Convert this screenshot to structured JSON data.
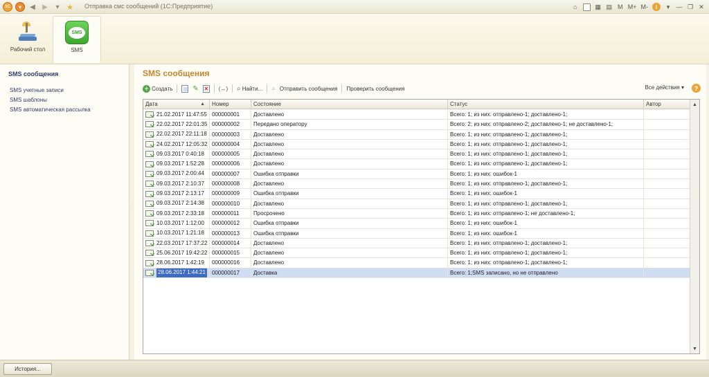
{
  "window": {
    "title": "Отправка смс сообщений  (1С:Предприятие)",
    "logo_text": "1С",
    "right_buttons": [
      "M",
      "M+",
      "M-"
    ]
  },
  "sections": [
    {
      "label": "Рабочий стол",
      "icon": "desktop-icon",
      "active": false
    },
    {
      "label": "SMS",
      "icon": "sms-icon",
      "active": true
    }
  ],
  "sms_icon_text": "SMS",
  "nav": {
    "header": "SMS сообщения",
    "items": [
      "SMS учетные записи",
      "SMS шаблоны",
      "SMS автоматическая рассылка"
    ]
  },
  "form": {
    "title": "SMS сообщения",
    "toolbar": {
      "create": "Создать",
      "find": "Найти...",
      "send": "Отправить сообщения",
      "check": "Проверить сообщения",
      "all_actions": "Все действия ▾",
      "exchange": "(↔)"
    }
  },
  "table": {
    "columns": [
      "Дата",
      "Номер",
      "Состояние",
      "Статус",
      "Автор"
    ],
    "rows": [
      {
        "date": "21.02.2017 11:47:55",
        "number": "000000001",
        "state": "Доставлено",
        "status": "Всего: 1; из них: отправлено-1; доставлено-1;",
        "author": ""
      },
      {
        "date": "22.02.2017 22:01:35",
        "number": "000000002",
        "state": "Передано оператору",
        "status": "Всего: 2; из них: отправлено-2; доставлено-1; не доставлено-1;",
        "author": ""
      },
      {
        "date": "22.02.2017 22:11:18",
        "number": "000000003",
        "state": "Доставлено",
        "status": "Всего: 1; из них: отправлено-1; доставлено-1;",
        "author": ""
      },
      {
        "date": "24.02.2017 12:05:32",
        "number": "000000004",
        "state": "Доставлено",
        "status": "Всего: 1; из них: отправлено-1; доставлено-1;",
        "author": ""
      },
      {
        "date": "09.03.2017 0:40:18",
        "number": "000000005",
        "state": "Доставлено",
        "status": "Всего: 1; из них: отправлено-1; доставлено-1;",
        "author": ""
      },
      {
        "date": "09.03.2017 1:52:28",
        "number": "000000006",
        "state": "Доставлено",
        "status": "Всего: 1; из них: отправлено-1; доставлено-1;",
        "author": ""
      },
      {
        "date": "09.03.2017 2:00:44",
        "number": "000000007",
        "state": "Ошибка отправки",
        "status": "Всего: 1; из них: ошибок-1",
        "author": ""
      },
      {
        "date": "09.03.2017 2:10:37",
        "number": "000000008",
        "state": "Доставлено",
        "status": "Всего: 1; из них: отправлено-1; доставлено-1;",
        "author": ""
      },
      {
        "date": "09.03.2017 2:13:17",
        "number": "000000009",
        "state": "Ошибка отправки",
        "status": "Всего: 1; из них: ошибок-1",
        "author": ""
      },
      {
        "date": "09.03.2017 2:14:38",
        "number": "000000010",
        "state": "Доставлено",
        "status": "Всего: 1; из них: отправлено-1; доставлено-1;",
        "author": ""
      },
      {
        "date": "09.03.2017 2:33:18",
        "number": "000000011",
        "state": "Просрочено",
        "status": "Всего: 1; из них: отправлено-1; не доставлено-1;",
        "author": ""
      },
      {
        "date": "10.03.2017 1:12:00",
        "number": "000000012",
        "state": "Ошибка отправки",
        "status": "Всего: 1; из них: ошибок-1",
        "author": ""
      },
      {
        "date": "10.03.2017 1:21:18",
        "number": "000000013",
        "state": "Ошибка отправки",
        "status": "Всего: 1; из них: ошибок-1",
        "author": ""
      },
      {
        "date": "22.03.2017 17:37:22",
        "number": "000000014",
        "state": "Доставлено",
        "status": "Всего: 1; из них: отправлено-1; доставлено-1;",
        "author": ""
      },
      {
        "date": "25.06.2017 19:42:22",
        "number": "000000015",
        "state": "Доставлено",
        "status": "Всего: 1; из них: отправлено-1; доставлено-1;",
        "author": ""
      },
      {
        "date": "28.06.2017 1:42:19",
        "number": "000000016",
        "state": "Доставлено",
        "status": "Всего: 1; из них: отправлено-1; доставлено-1;",
        "author": ""
      },
      {
        "date": "28.06.2017 1:44:21",
        "number": "000000017",
        "state": "Доставка",
        "status": "Всего: 1;SMS записано, но не отправлено",
        "author": "",
        "selected": true
      }
    ]
  },
  "bottom": {
    "history_button": "История..."
  }
}
